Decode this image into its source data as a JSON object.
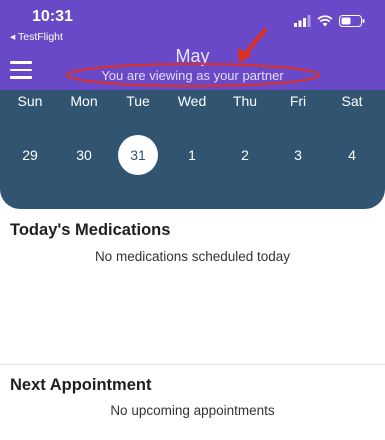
{
  "status_bar": {
    "time": "10:31",
    "back_app": "◂ TestFlight",
    "signal_icon": "signal-icon",
    "wifi_icon": "wifi-icon",
    "battery_icon": "battery-icon"
  },
  "header": {
    "month": "May",
    "viewing_note": "You are viewing as your partner",
    "menu_icon": "hamburger-menu-icon",
    "accent_color": "#6a49c9",
    "annotation_color": "#e2301f"
  },
  "calendar": {
    "background_color": "#315471",
    "weekdays": [
      "Sun",
      "Mon",
      "Tue",
      "Wed",
      "Thu",
      "Fri",
      "Sat"
    ],
    "days": [
      "29",
      "30",
      "31",
      "1",
      "2",
      "3",
      "4"
    ],
    "selected_day": "31"
  },
  "medications": {
    "title": "Today's Medications",
    "empty_text": "No medications scheduled today"
  },
  "appointments": {
    "title": "Next Appointment",
    "empty_text": "No upcoming appointments"
  }
}
